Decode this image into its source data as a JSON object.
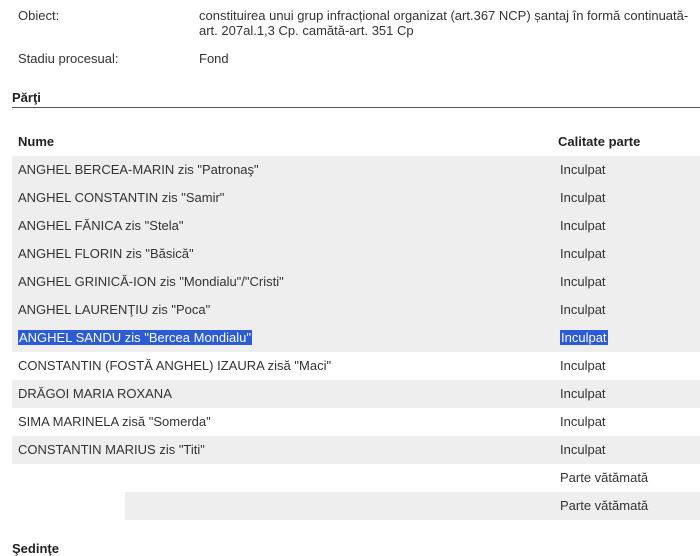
{
  "info": {
    "obiect_label": "Obiect:",
    "obiect_value": "constituirea unui grup infracțional organizat (art.367 NCP) șantaj în formă continuată-art. 207al.1,3 Cp. camătă-art. 351 Cp",
    "stadiu_label": "Stadiu procesual:",
    "stadiu_value": "Fond"
  },
  "parti": {
    "section_title": "Părţi",
    "columns": {
      "name": "Nume",
      "role": "Calitate parte"
    },
    "rows": [
      {
        "name": "ANGHEL BERCEA-MARIN zis \"Patronaş\"",
        "role": "Inculpat"
      },
      {
        "name": "ANGHEL CONSTANTIN zis \"Samir\"",
        "role": "Inculpat"
      },
      {
        "name": "ANGHEL FĂNICA zis \"Stela\"",
        "role": "Inculpat"
      },
      {
        "name": "ANGHEL FLORIN zis \"Băsică\"",
        "role": "Inculpat"
      },
      {
        "name": "ANGHEL GRINICĂ-ION zis \"Mondialu\"/\"Cristi\"",
        "role": "Inculpat"
      },
      {
        "name": "ANGHEL LAURENŢIU zis \"Poca\"",
        "role": "Inculpat"
      },
      {
        "name": "ANGHEL SANDU zis \"Bercea Mondialu\"",
        "role": "Inculpat"
      },
      {
        "name": "CONSTANTIN (FOSTĂ ANGHEL) IZAURA zisă \"Maci\"",
        "role": "Inculpat"
      },
      {
        "name": "DRĂGOI MARIA ROXANA",
        "role": "Inculpat"
      },
      {
        "name": "SIMA MARINELA zisă \"Somerda\"",
        "role": "Inculpat"
      },
      {
        "name": "CONSTANTIN MARIUS zis \"Titi\"",
        "role": "Inculpat"
      },
      {
        "name": "",
        "role": "Parte vătămată"
      },
      {
        "name": "",
        "role": "Parte vătămată"
      }
    ]
  },
  "sedinte": {
    "section_title": "Şedinţe"
  }
}
